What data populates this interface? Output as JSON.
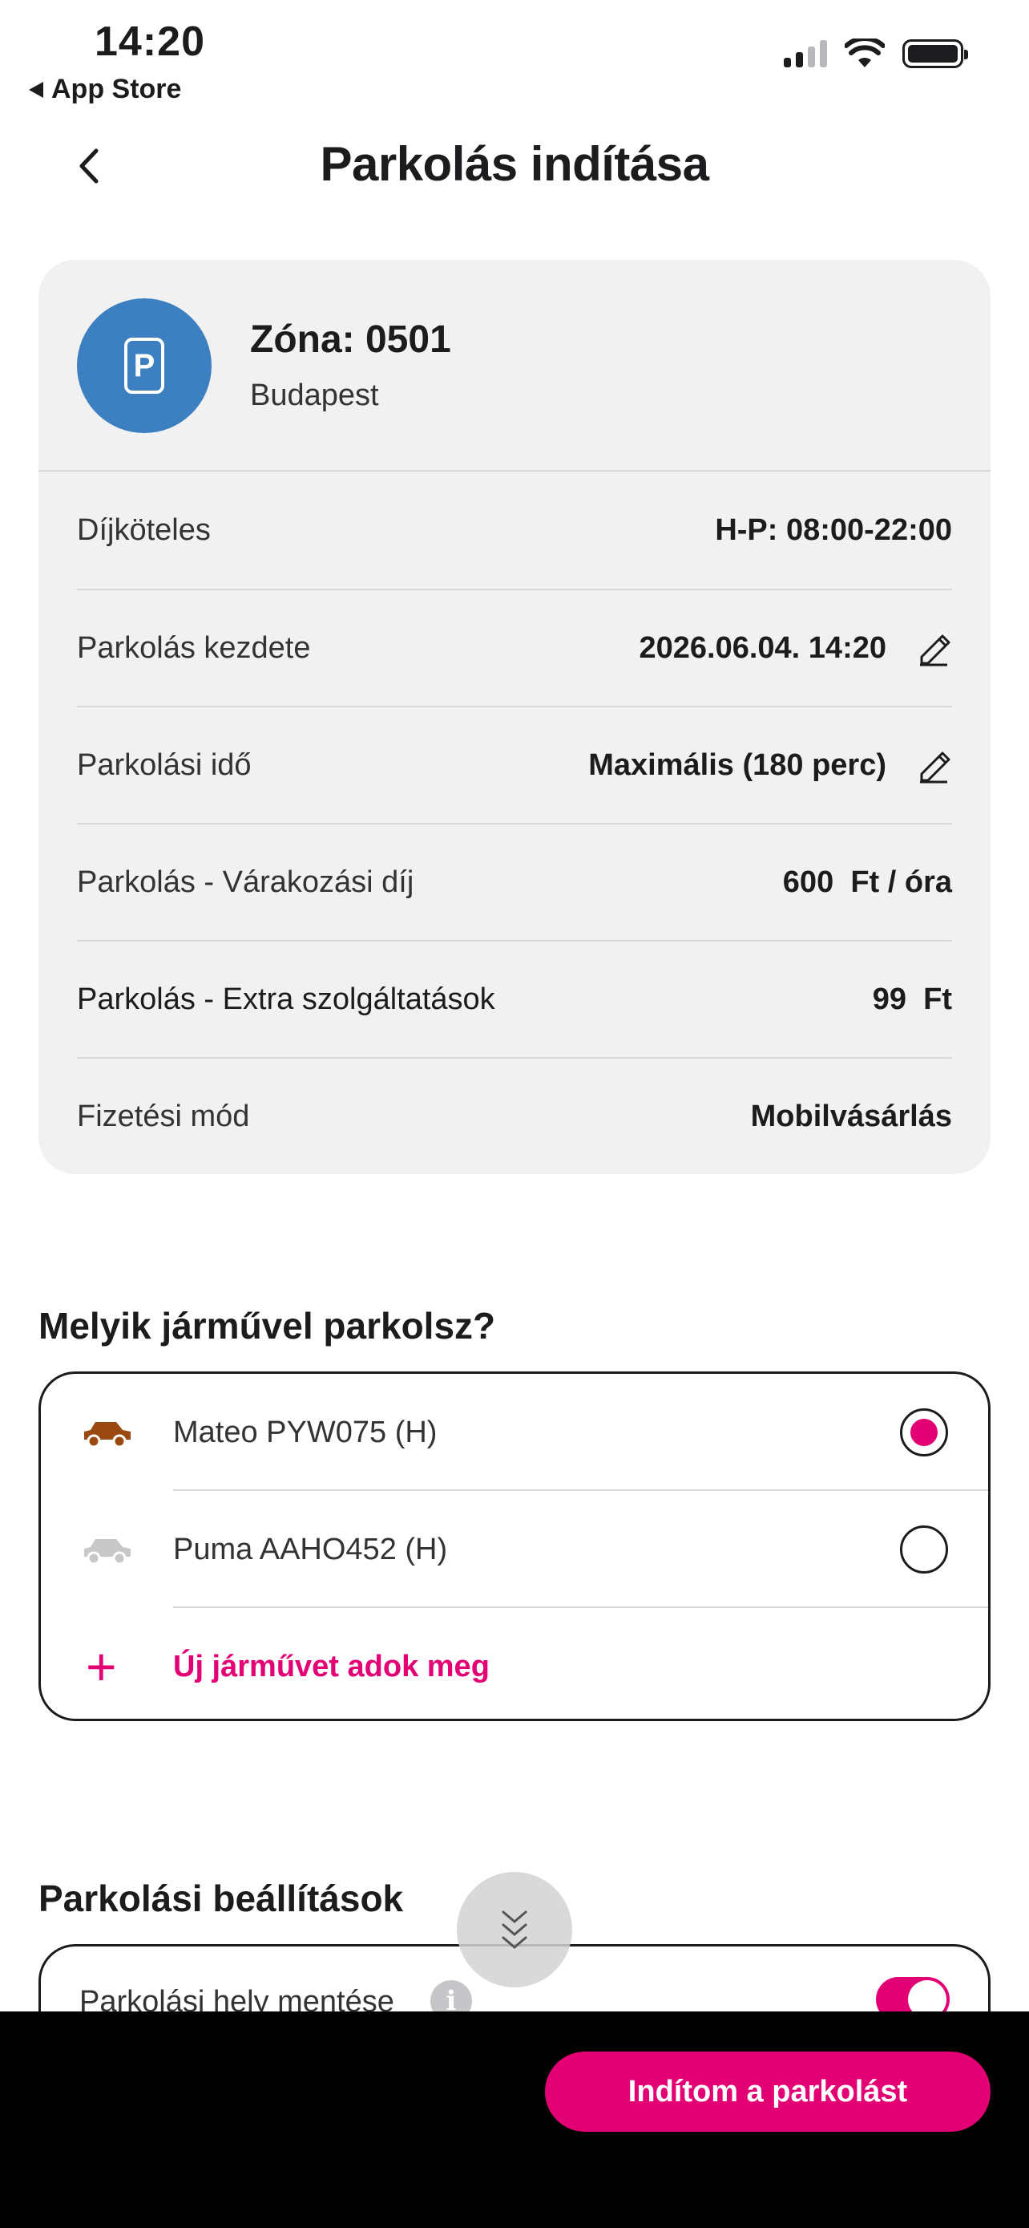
{
  "status_bar": {
    "time": "14:20",
    "back_app": "App Store"
  },
  "header": {
    "title": "Parkolás indítása"
  },
  "zone": {
    "name": "Zóna: 0501",
    "city": "Budapest",
    "icon_letter": "P",
    "avatar_color": "#3d80c2",
    "rows": [
      {
        "label": "Díjköteles",
        "value": "H-P: 08:00-22:00"
      },
      {
        "label": "Parkolás kezdete",
        "value": "2026.06.04. 14:20"
      },
      {
        "label": "Parkolási idő",
        "value": "Maximális (180 perc)"
      },
      {
        "label": "Parkolás - Várakozási díj",
        "value": "600  Ft / óra"
      },
      {
        "label": "Parkolás - Extra szolgáltatások",
        "value": "99  Ft"
      },
      {
        "label": "Fizetési mód",
        "value": "Mobilvásárlás"
      }
    ]
  },
  "vehicles": {
    "title": "Melyik járművel parkolsz?",
    "items": [
      {
        "label": "Mateo PYW075 (H)",
        "selected": true,
        "car_color": "#9a4a10"
      },
      {
        "label": "Puma AAHO452 (H)",
        "selected": false,
        "car_color": "#c8c8c8"
      }
    ],
    "add_label": "Új járművet adok meg",
    "plus_symbol": "+"
  },
  "settings": {
    "title": "Parkolási beállítások",
    "save_location_label": "Parkolási hely mentése",
    "info_symbol": "i",
    "save_location_enabled": true
  },
  "footer": {
    "start_button": "Indítom a parkolást"
  },
  "colors": {
    "accent": "#e20074",
    "card_bg": "#f1f1f1",
    "bottom_bar": "#000000"
  }
}
